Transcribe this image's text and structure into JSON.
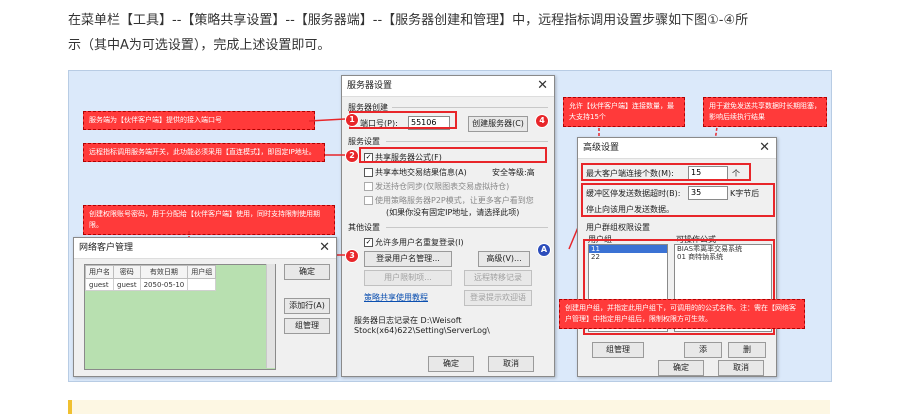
{
  "intro": {
    "line1": "在菜单栏【工具】--【策略共享设置】--【服务器端】--【服务器创建和管理】中，远程指标调用设置步骤如下图①-④所",
    "line2": "示（其中A为可选设置），完成上述设置即可。"
  },
  "server_dialog": {
    "title": "服务器设置",
    "close": "✕",
    "section_create": "服务器创建",
    "port_label": "端口号(P):",
    "port_value": "55106",
    "create_button": "创建服务器(C)",
    "section_service": "服务设置",
    "share_formula": "共享服务器公式(F)",
    "share_trade_result": "共享本地交易结果信息(A)",
    "security_level": "安全等级:高",
    "send_sync_disabled": "发送持仓同步(仅限图表交易虚拟持仓)",
    "p2p_mode_disabled": "使用策略服务器P2P模式，让更多客户看到您",
    "p2p_note": "(如果你没有固定IP地址，请选择此项)",
    "section_other": "其他设置",
    "allow_repeat_login": "允许多用户名重复登录(I)",
    "login_user_manage": "登录用户名管理...",
    "advanced_button": "高级(V)...",
    "user_limit_button": "用户限制项...",
    "remote_transfer_button": "远程转移记录",
    "login_prompt_button": "登录提示欢迎语",
    "tutorial_link": "策略共享使用教程",
    "log_text": "服务器日志记录在 D:\\Weisoft Stock(x64)622\\Setting\\ServerLog\\",
    "ok": "确定",
    "cancel": "取消"
  },
  "client_dialog": {
    "title": "网络客户管理",
    "close": "✕",
    "columns": [
      "用户名",
      "密码",
      "有效日期",
      "用户组"
    ],
    "rows": [
      [
        "guest",
        "guest",
        "2050-05-10",
        ""
      ]
    ],
    "ok": "确定",
    "add_row": "添加行(A)",
    "group_manage": "组管理"
  },
  "advanced_dialog": {
    "title": "高级设置",
    "close": "✕",
    "max_connections_label": "最大客户端连接个数(M):",
    "max_connections_value": "15",
    "max_connections_unit": "个",
    "buffer_label": "缓冲区停发送数据超时(B):",
    "buffer_value": "35",
    "buffer_unit": "K字节后",
    "buffer_note": "停止向该用户发送数据。",
    "group_section": "用户群组权限设置",
    "group_col": "用户组",
    "formula_col": "可操作公式",
    "groups": [
      "11",
      "22"
    ],
    "formulas": [
      "BIAS乖离率交易系统",
      "01 商特钠系统"
    ],
    "group_manage": "组管理",
    "add": "添",
    "delete": "删",
    "ok": "确定",
    "cancel": "取消"
  },
  "annotations": {
    "port_note": "服务端为【伙伴客户端】提供的接入端口号",
    "switch_note": "远程指标调用服务端开关，此功能必须采用【直连模式】，即固定IP地址。",
    "account_note": "创建权限账号密码，用于分配给【伙伴客户端】使用，同时支持限制使用期限。",
    "connection_note": "允许【伙伴客户端】连接数量，最大支持15个",
    "timeout_note": "用于避免发送共享数据时长期阻塞，影响后续执行结果",
    "group_note": "创建用户组，并指定此用户组下，可调用的的公式名称。注：需在【网络客户管理】中指定用户组后，限制权限方可生效。",
    "marker1": "1",
    "marker2": "2",
    "marker3": "3",
    "marker4": "4",
    "markerA": "A"
  },
  "colors": {
    "annotation_red": "#ff3a3a",
    "marker_blue": "#2c4dbb",
    "link_blue": "#0b4fb0",
    "backdrop": "#dbe9fa"
  }
}
